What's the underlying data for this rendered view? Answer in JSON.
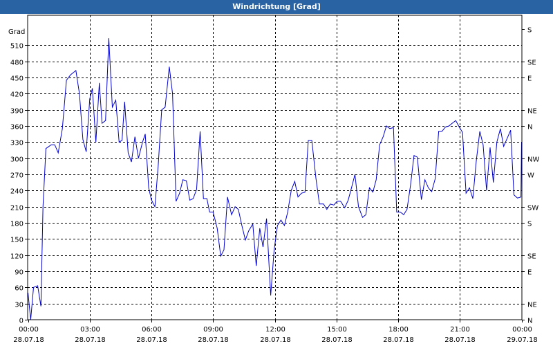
{
  "window": {
    "title": "Windrichtung [Grad]"
  },
  "chart_data": {
    "type": "line",
    "title": "Windrichtung [Grad]",
    "ylabel": "Grad",
    "ylim": [
      0,
      540
    ],
    "yticks": [
      0,
      30,
      60,
      90,
      120,
      150,
      180,
      210,
      240,
      270,
      300,
      330,
      360,
      390,
      420,
      450,
      480,
      510
    ],
    "right_ticks": [
      {
        "value": 0,
        "label": "N"
      },
      {
        "value": 30,
        "label": "NE"
      },
      {
        "value": 90,
        "label": "E"
      },
      {
        "value": 120,
        "label": "SE"
      },
      {
        "value": 180,
        "label": "S"
      },
      {
        "value": 210,
        "label": "SW"
      },
      {
        "value": 270,
        "label": "W"
      },
      {
        "value": 300,
        "label": "NW"
      },
      {
        "value": 360,
        "label": "N"
      },
      {
        "value": 390,
        "label": "NE"
      },
      {
        "value": 450,
        "label": "E"
      },
      {
        "value": 480,
        "label": "SE"
      },
      {
        "value": 540,
        "label": "S"
      }
    ],
    "x_ticks": [
      {
        "time": "00:00",
        "date": "28.07.18"
      },
      {
        "time": "03:00",
        "date": "28.07.18"
      },
      {
        "time": "06:00",
        "date": "28.07.18"
      },
      {
        "time": "09:00",
        "date": "28.07.18"
      },
      {
        "time": "12:00",
        "date": "28.07.18"
      },
      {
        "time": "15:00",
        "date": "28.07.18"
      },
      {
        "time": "18:00",
        "date": "28.07.18"
      },
      {
        "time": "21:00",
        "date": "28.07.18"
      },
      {
        "time": "00:00",
        "date": "29.07.18"
      }
    ],
    "xlim_hours": [
      0,
      24
    ],
    "grid": true,
    "series": [
      {
        "color": "#0000cc",
        "points": [
          [
            0,
            50
          ],
          [
            0.13,
            0
          ],
          [
            0.27,
            60
          ],
          [
            0.47,
            63
          ],
          [
            0.63,
            25
          ],
          [
            0.73,
            210
          ],
          [
            0.87,
            318
          ],
          [
            1.13,
            325
          ],
          [
            1.3,
            325
          ],
          [
            1.47,
            310
          ],
          [
            1.67,
            355
          ],
          [
            1.87,
            445
          ],
          [
            2.07,
            455
          ],
          [
            2.33,
            463
          ],
          [
            2.5,
            420
          ],
          [
            2.67,
            335
          ],
          [
            2.83,
            312
          ],
          [
            3.0,
            410
          ],
          [
            3.13,
            430
          ],
          [
            3.3,
            330
          ],
          [
            3.47,
            440
          ],
          [
            3.6,
            365
          ],
          [
            3.77,
            370
          ],
          [
            3.93,
            523
          ],
          [
            4.1,
            395
          ],
          [
            4.27,
            408
          ],
          [
            4.43,
            330
          ],
          [
            4.57,
            333
          ],
          [
            4.7,
            405
          ],
          [
            4.87,
            310
          ],
          [
            5.03,
            293
          ],
          [
            5.2,
            340
          ],
          [
            5.37,
            300
          ],
          [
            5.57,
            330
          ],
          [
            5.7,
            345
          ],
          [
            5.87,
            245
          ],
          [
            6.0,
            223
          ],
          [
            6.17,
            210
          ],
          [
            6.33,
            285
          ],
          [
            6.5,
            390
          ],
          [
            6.67,
            395
          ],
          [
            6.87,
            470
          ],
          [
            7.03,
            420
          ],
          [
            7.2,
            220
          ],
          [
            7.37,
            235
          ],
          [
            7.53,
            260
          ],
          [
            7.7,
            258
          ],
          [
            7.87,
            222
          ],
          [
            8.03,
            225
          ],
          [
            8.2,
            242
          ],
          [
            8.37,
            350
          ],
          [
            8.53,
            225
          ],
          [
            8.7,
            225
          ],
          [
            8.83,
            200
          ],
          [
            9.0,
            200
          ],
          [
            9.2,
            170
          ],
          [
            9.37,
            118
          ],
          [
            9.53,
            130
          ],
          [
            9.7,
            228
          ],
          [
            9.9,
            195
          ],
          [
            10.07,
            210
          ],
          [
            10.23,
            205
          ],
          [
            10.4,
            175
          ],
          [
            10.57,
            148
          ],
          [
            10.73,
            165
          ],
          [
            10.93,
            178
          ],
          [
            11.1,
            100
          ],
          [
            11.27,
            170
          ],
          [
            11.43,
            135
          ],
          [
            11.6,
            188
          ],
          [
            11.8,
            45
          ],
          [
            11.97,
            130
          ],
          [
            12.13,
            175
          ],
          [
            12.3,
            185
          ],
          [
            12.47,
            175
          ],
          [
            12.63,
            200
          ],
          [
            12.8,
            240
          ],
          [
            12.97,
            257
          ],
          [
            13.13,
            228
          ],
          [
            13.3,
            235
          ],
          [
            13.47,
            237
          ],
          [
            13.63,
            333
          ],
          [
            13.8,
            333
          ],
          [
            14.0,
            263
          ],
          [
            14.17,
            215
          ],
          [
            14.37,
            215
          ],
          [
            14.53,
            205
          ],
          [
            14.7,
            215
          ],
          [
            14.87,
            213
          ],
          [
            15.03,
            220
          ],
          [
            15.2,
            220
          ],
          [
            15.4,
            208
          ],
          [
            15.57,
            222
          ],
          [
            15.73,
            245
          ],
          [
            15.9,
            270
          ],
          [
            16.07,
            210
          ],
          [
            16.27,
            190
          ],
          [
            16.43,
            195
          ],
          [
            16.6,
            245
          ],
          [
            16.77,
            237
          ],
          [
            16.93,
            260
          ],
          [
            17.1,
            325
          ],
          [
            17.27,
            340
          ],
          [
            17.43,
            360
          ],
          [
            17.6,
            355
          ],
          [
            17.77,
            357
          ],
          [
            17.93,
            200
          ],
          [
            18.1,
            200
          ],
          [
            18.27,
            195
          ],
          [
            18.43,
            205
          ],
          [
            18.6,
            250
          ],
          [
            18.77,
            305
          ],
          [
            18.93,
            302
          ],
          [
            19.13,
            223
          ],
          [
            19.3,
            260
          ],
          [
            19.47,
            245
          ],
          [
            19.63,
            238
          ],
          [
            19.8,
            262
          ],
          [
            19.97,
            350
          ],
          [
            20.13,
            350
          ],
          [
            20.3,
            358
          ],
          [
            20.47,
            360
          ],
          [
            20.63,
            365
          ],
          [
            20.8,
            370
          ],
          [
            20.97,
            358
          ],
          [
            21.13,
            348
          ],
          [
            21.3,
            235
          ],
          [
            21.47,
            245
          ],
          [
            21.63,
            225
          ],
          [
            21.8,
            295
          ],
          [
            21.97,
            350
          ],
          [
            22.13,
            325
          ],
          [
            22.3,
            240
          ],
          [
            22.47,
            320
          ],
          [
            22.63,
            255
          ],
          [
            22.8,
            330
          ],
          [
            22.97,
            355
          ],
          [
            23.13,
            322
          ],
          [
            23.3,
            337
          ],
          [
            23.47,
            352
          ],
          [
            23.63,
            232
          ],
          [
            23.8,
            226
          ],
          [
            23.97,
            228
          ],
          [
            24.0,
            330
          ]
        ]
      }
    ]
  }
}
